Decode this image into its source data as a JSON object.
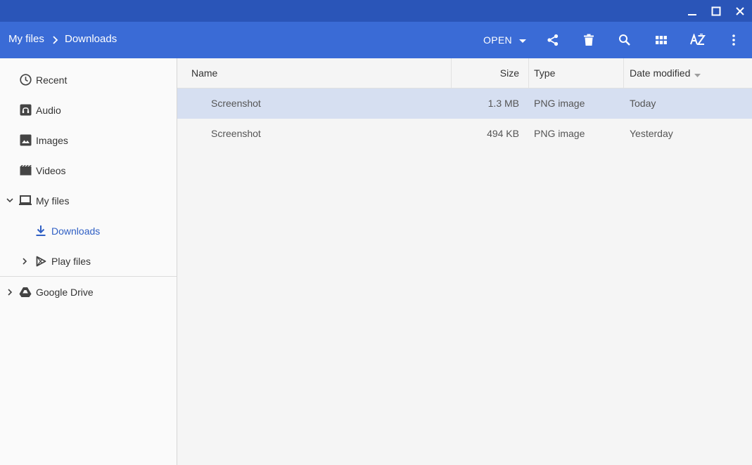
{
  "window": {
    "minimize_icon": "minimize-icon",
    "maximize_icon": "maximize-icon",
    "close_icon": "close-icon"
  },
  "breadcrumb": [
    "My files",
    "Downloads"
  ],
  "toolbar": {
    "open_label": "OPEN",
    "icons": [
      "share-icon",
      "delete-icon",
      "search-icon",
      "grid-view-icon",
      "sort-az-icon",
      "more-vert-icon"
    ]
  },
  "sidebar": {
    "items": [
      {
        "label": "Recent",
        "icon": "clock-icon"
      },
      {
        "label": "Audio",
        "icon": "audio-icon"
      },
      {
        "label": "Images",
        "icon": "image-icon"
      },
      {
        "label": "Videos",
        "icon": "video-icon"
      },
      {
        "label": "My files",
        "icon": "laptop-icon",
        "expanded": true
      },
      {
        "label": "Downloads",
        "icon": "download-icon",
        "active": true
      },
      {
        "label": "Play files",
        "icon": "play-store-icon",
        "expanded": false
      },
      {
        "label": "Google Drive",
        "icon": "drive-icon",
        "expanded": false
      }
    ]
  },
  "file_list": {
    "columns": [
      "Name",
      "Size",
      "Type",
      "Date modified"
    ],
    "sorted_by": "Date modified",
    "rows": [
      {
        "name": "Screenshot",
        "size": "1.3 MB",
        "type": "PNG image",
        "date": "Today",
        "selected": true
      },
      {
        "name": "Screenshot",
        "size": "494 KB",
        "type": "PNG image",
        "date": "Yesterday",
        "selected": false
      }
    ]
  },
  "colors": {
    "titlebar": "#2a55b8",
    "toolbar": "#3a6bd6",
    "selection": "#d6dff1",
    "active_nav": "#2f5fc4"
  }
}
